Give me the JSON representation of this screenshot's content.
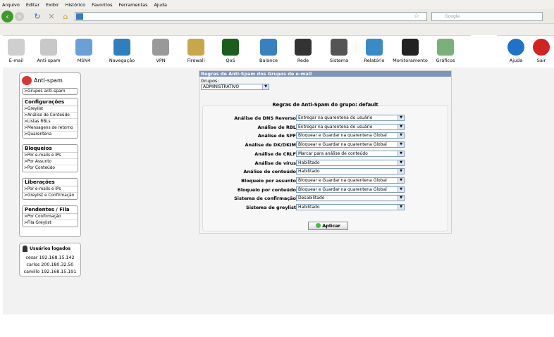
{
  "browser": {
    "menu": [
      "Arquivo",
      "Editar",
      "Exibir",
      "Histórico",
      "Favoritos",
      "Ferramentas",
      "Ajuda"
    ],
    "search_placeholder": "Google"
  },
  "toolbar": [
    {
      "label": "E-mail",
      "color": "#cfcfcf"
    },
    {
      "label": "Anti-spam",
      "color": "#c8c8c8"
    },
    {
      "label": "MSN4",
      "color": "#6a9fd8"
    },
    {
      "label": "Navegação",
      "color": "#2f7fbf"
    },
    {
      "label": "VPN",
      "color": "#999"
    },
    {
      "label": "Firewall",
      "color": "#c8a64a"
    },
    {
      "label": "QoS",
      "color": "#1b5e1b"
    },
    {
      "label": "Balance",
      "color": "#3a7fc0"
    },
    {
      "label": "Rede",
      "color": "#333"
    },
    {
      "label": "Sistema",
      "color": "#555"
    },
    {
      "label": "Relatório",
      "color": "#3a8ac8"
    },
    {
      "label": "Monitoramento",
      "color": "#222"
    },
    {
      "label": "Gráficos",
      "color": "#7ab07a"
    },
    {
      "label": "Ajuda",
      "color": "#1e73c8"
    },
    {
      "label": "Sair",
      "color": "#d42222"
    }
  ],
  "sidebar": {
    "title": "Anti-spam",
    "top_link": ">Grupos anti-spam",
    "groups": [
      {
        "title": "Configurações",
        "items": [
          ">Greylist",
          ">Análise de Conteúdo",
          ">Listas RBLs",
          ">Mensagens de retorno",
          ">Quarentena"
        ]
      },
      {
        "title": "Bloqueios",
        "items": [
          ">Por e-mails e IPs",
          ">Por Assunto",
          ">Por Conteúdo"
        ]
      },
      {
        "title": "Liberações",
        "items": [
          ">Por e-mails e IPs",
          ">Greylist e Confirmação"
        ]
      },
      {
        "title": "Pendentes / Fila",
        "items": [
          ">Por Confirmação",
          ">Fila Greylist"
        ]
      }
    ]
  },
  "users": {
    "title": "Usuários logados",
    "list": [
      {
        "name": "cesar",
        "ip": "192.168.15.142"
      },
      {
        "name": "carlos",
        "ip": "200.180.32.50"
      },
      {
        "name": "camillo",
        "ip": "192.168.15.191"
      }
    ]
  },
  "panel": {
    "title": "Regras de Anti-Spam dos Grupos de e-mail",
    "groups_label": "Grupos:",
    "groups_value": "ADMINISTRATIVO",
    "rules_title": "Regras de Anti-Spam do grupo: default",
    "rules": [
      {
        "label": "Análise de DNS Reverso",
        "value": "Entregar na quarentena do usuário"
      },
      {
        "label": "Análise de RBL",
        "value": "Entregar na quarentena do usuário"
      },
      {
        "label": "Análise de SPF",
        "value": "Bloquear e Guardar na quarentena Global"
      },
      {
        "label": "Análise de DK/DKIM",
        "value": "Bloquear e Guardar na quarentena Global"
      },
      {
        "label": "Análise de CRLF",
        "value": "Marcar para análise de conteúdo"
      },
      {
        "label": "Análise de vírus",
        "value": "Habilitado"
      },
      {
        "label": "Análise de conteúdo",
        "value": "Habilitado"
      },
      {
        "label": "Bloqueio por assunto",
        "value": "Bloquear e Guardar na quarentena Global"
      },
      {
        "label": "Bloqueio por conteúdo",
        "value": "Bloquear e Guardar na quarentena Global"
      },
      {
        "label": "Sistema de confirmação",
        "value": "Desabilitado"
      },
      {
        "label": "Sistema de greylist",
        "value": "Habilitado"
      }
    ],
    "apply_label": "Aplicar"
  }
}
